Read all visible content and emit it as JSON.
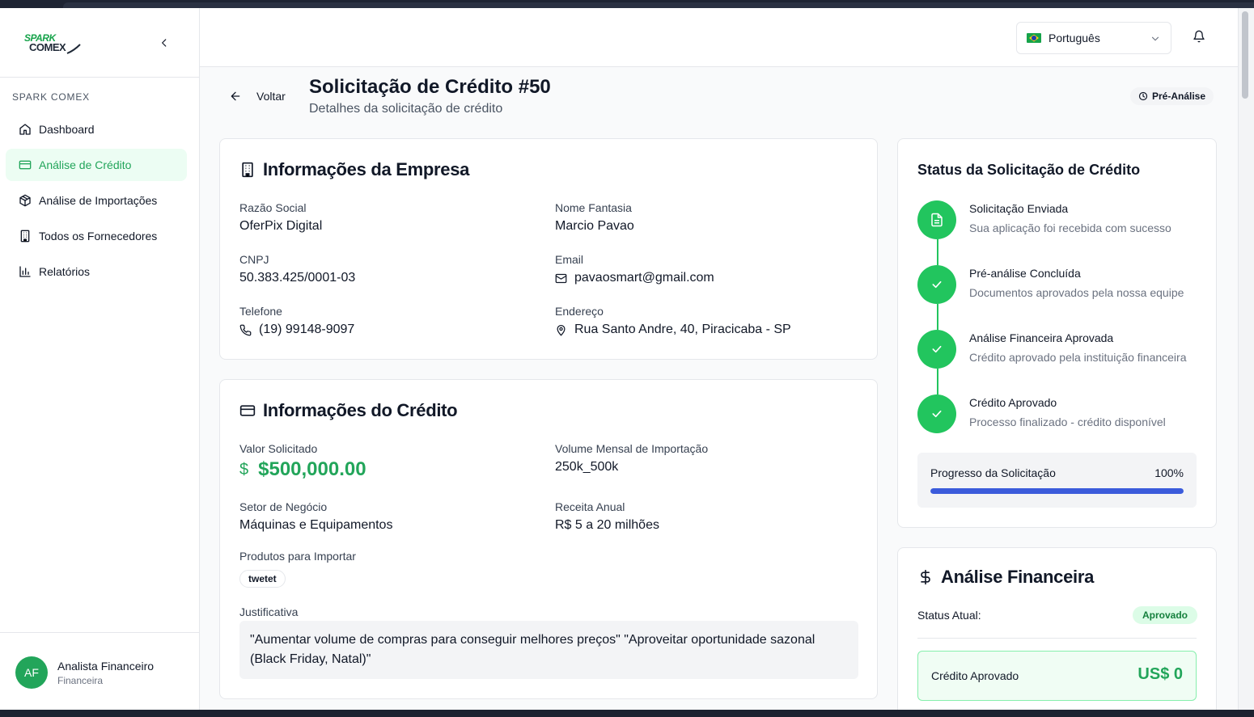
{
  "sidebar": {
    "logo_top": "SPARK",
    "logo_bottom": "COMEX",
    "section": "SPARK COMEX",
    "items": [
      {
        "label": "Dashboard",
        "icon": "home-icon",
        "active": false
      },
      {
        "label": "Análise de Crédito",
        "icon": "credit-card-icon",
        "active": true
      },
      {
        "label": "Análise de Importações",
        "icon": "package-icon",
        "active": false
      },
      {
        "label": "Todos os Fornecedores",
        "icon": "building-icon",
        "active": false
      },
      {
        "label": "Relatórios",
        "icon": "bar-chart-icon",
        "active": false
      }
    ],
    "user": {
      "initials": "AF",
      "name": "Analista Financeiro",
      "role": "Financeira"
    }
  },
  "header": {
    "language": "Português"
  },
  "page": {
    "back_label": "Voltar",
    "title": "Solicitação de Crédito #50",
    "subtitle": "Detalhes da solicitação de crédito",
    "status": "Pré-Análise"
  },
  "company": {
    "title": "Informações da Empresa",
    "razao_label": "Razão Social",
    "razao_value": "OferPix Digital",
    "fantasia_label": "Nome Fantasia",
    "fantasia_value": "Marcio Pavao",
    "cnpj_label": "CNPJ",
    "cnpj_value": "50.383.425/0001-03",
    "email_label": "Email",
    "email_value": "pavaosmart@gmail.com",
    "phone_label": "Telefone",
    "phone_value": "(19) 99148-9097",
    "address_label": "Endereço",
    "address_value": "Rua Santo Andre, 40, Piracicaba - SP"
  },
  "credit": {
    "title": "Informações do Crédito",
    "valor_label": "Valor Solicitado",
    "valor_currency": "$",
    "valor_value": "$500,000.00",
    "volume_label": "Volume Mensal de Importação",
    "volume_value": "250k_500k",
    "setor_label": "Setor de Negócio",
    "setor_value": "Máquinas e Equipamentos",
    "receita_label": "Receita Anual",
    "receita_value": "R$ 5 a 20 milhões",
    "produtos_label": "Produtos para Importar",
    "produtos": [
      "twetet"
    ],
    "justificativa_label": "Justificativa",
    "justificativa_value": "\"Aumentar volume de compras para conseguir melhores preços\" \"Aproveitar oportunidade sazonal (Black Friday, Natal)\""
  },
  "status": {
    "title": "Status da Solicitação de Crédito",
    "steps": [
      {
        "title": "Solicitação Enviada",
        "desc": "Sua aplicação foi recebida com sucesso",
        "icon": "file-text-icon"
      },
      {
        "title": "Pré-análise Concluída",
        "desc": "Documentos aprovados pela nossa equipe",
        "icon": "check-icon"
      },
      {
        "title": "Análise Financeira Aprovada",
        "desc": "Crédito aprovado pela instituição financeira",
        "icon": "check-icon"
      },
      {
        "title": "Crédito Aprovado",
        "desc": "Processo finalizado - crédito disponível",
        "icon": "check-icon"
      }
    ],
    "progress_label": "Progresso da Solicitação",
    "progress_text": "100%",
    "progress_value": 1.0
  },
  "financial": {
    "title": "Análise Financeira",
    "status_label": "Status Atual:",
    "status_badge": "Aprovado",
    "approved_label": "Crédito Aprovado",
    "approved_value": "US$ 0"
  },
  "colors": {
    "accent": "#22a55a",
    "progress": "#3b5bdb",
    "timeline": "#22c55e"
  }
}
